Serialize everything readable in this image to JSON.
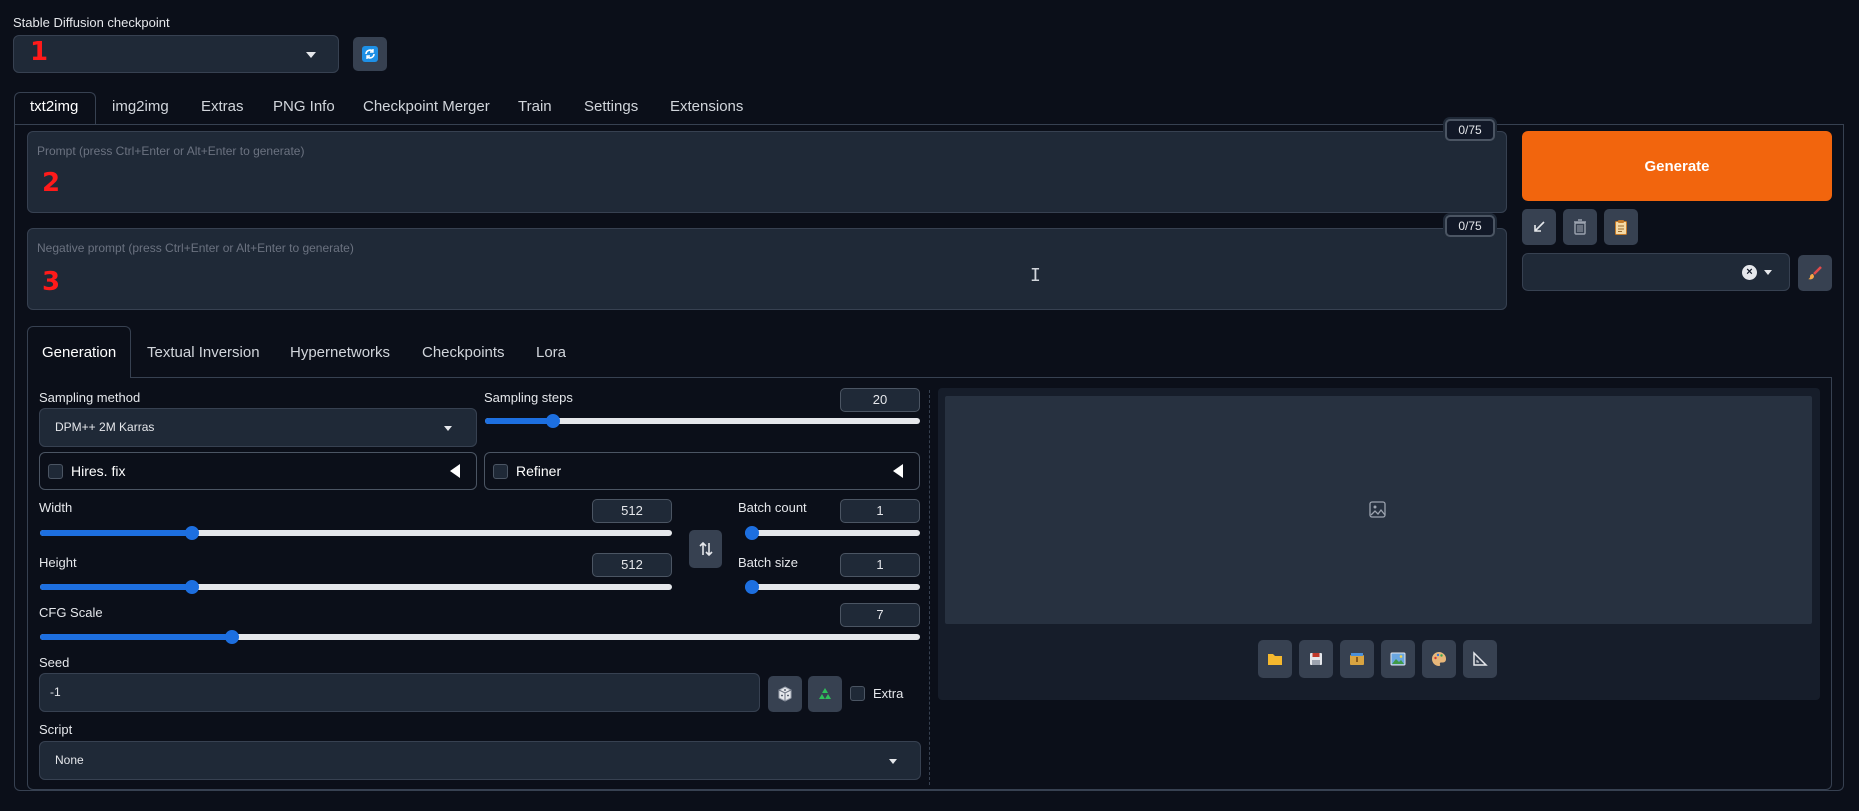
{
  "checkpoint": {
    "label": "Stable Diffusion checkpoint",
    "value": "",
    "marker": "1"
  },
  "main_tabs": [
    {
      "label": "txt2img",
      "active": true
    },
    {
      "label": "img2img"
    },
    {
      "label": "Extras"
    },
    {
      "label": "PNG Info"
    },
    {
      "label": "Checkpoint Merger"
    },
    {
      "label": "Train"
    },
    {
      "label": "Settings"
    },
    {
      "label": "Extensions"
    }
  ],
  "prompt": {
    "placeholder": "Prompt (press Ctrl+Enter or Alt+Enter to generate)",
    "counter": "0/75",
    "marker": "2"
  },
  "negative_prompt": {
    "placeholder": "Negative prompt (press Ctrl+Enter or Alt+Enter to generate)",
    "counter": "0/75",
    "marker": "3"
  },
  "generate": {
    "label": "Generate",
    "color": "#f2650d"
  },
  "sub_tabs": [
    {
      "label": "Generation",
      "active": true
    },
    {
      "label": "Textual Inversion"
    },
    {
      "label": "Hypernetworks"
    },
    {
      "label": "Checkpoints"
    },
    {
      "label": "Lora"
    }
  ],
  "sampling": {
    "method_label": "Sampling method",
    "method_value": "DPM++ 2M Karras",
    "steps_label": "Sampling steps",
    "steps_value": "20",
    "steps_fraction": 0.14
  },
  "hires": {
    "label": "Hires. fix"
  },
  "refiner": {
    "label": "Refiner"
  },
  "width": {
    "label": "Width",
    "value": "512",
    "fraction": 0.23
  },
  "height": {
    "label": "Height",
    "value": "512",
    "fraction": 0.23
  },
  "batch_count": {
    "label": "Batch count",
    "value": "1",
    "fraction": 0.0
  },
  "batch_size": {
    "label": "Batch size",
    "value": "1",
    "fraction": 0.0
  },
  "cfg": {
    "label": "CFG Scale",
    "value": "7",
    "fraction": 0.21
  },
  "seed": {
    "label": "Seed",
    "value": "-1",
    "extra_label": "Extra"
  },
  "script": {
    "label": "Script",
    "value": "None"
  },
  "colors": {
    "accent": "#1d6fe0",
    "background": "#0b0f19",
    "panel": "#1f2937"
  }
}
